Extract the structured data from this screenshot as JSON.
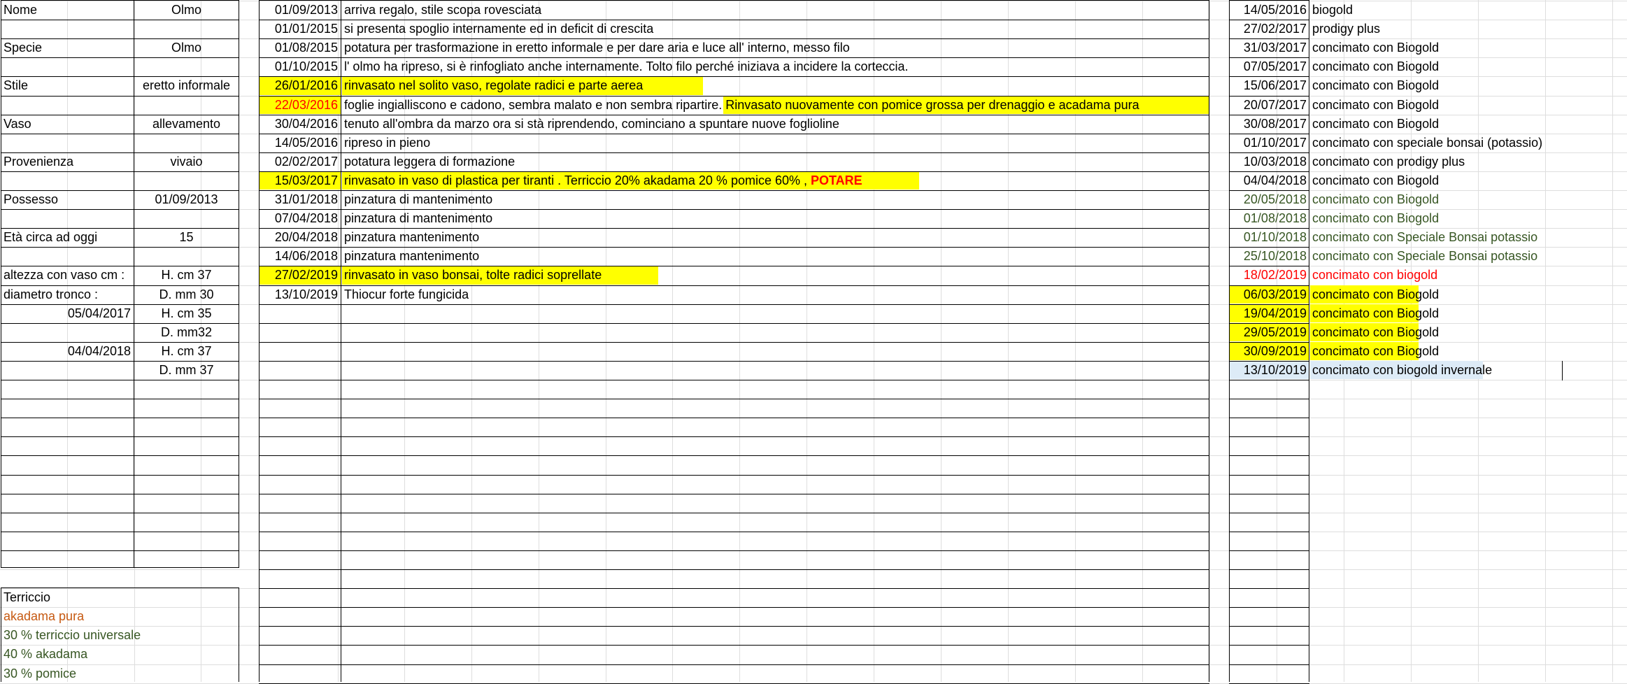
{
  "colors": {
    "highlight": "#ffff00",
    "light_blue": "#ddebf7",
    "red": "#ff0000",
    "green": "#375623",
    "orange": "#c65911"
  },
  "info": {
    "rows": [
      {
        "label": "Nome",
        "value": "Olmo"
      },
      {
        "label": "",
        "value": ""
      },
      {
        "label": "Specie",
        "value": "Olmo"
      },
      {
        "label": "",
        "value": ""
      },
      {
        "label": "Stile",
        "value": "eretto informale"
      },
      {
        "label": "",
        "value": ""
      },
      {
        "label": "Vaso",
        "value": "allevamento"
      },
      {
        "label": "",
        "value": ""
      },
      {
        "label": "Provenienza",
        "value": "vivaio"
      },
      {
        "label": "",
        "value": ""
      },
      {
        "label": "Possesso",
        "value": "01/09/2013"
      },
      {
        "label": "",
        "value": ""
      },
      {
        "label": "Età circa ad oggi",
        "value": "15"
      },
      {
        "label": "",
        "value": ""
      },
      {
        "label": "altezza con vaso cm :",
        "value": "H. cm 37"
      },
      {
        "label": "diametro tronco :",
        "value": "D. mm 30"
      },
      {
        "label": "05/04/2017",
        "value": "H. cm 35",
        "label_align": "right"
      },
      {
        "label": "",
        "value": "D. mm32"
      },
      {
        "label": "04/04/2018",
        "value": "H. cm 37",
        "label_align": "right"
      },
      {
        "label": "",
        "value": "D. mm 37"
      }
    ]
  },
  "soil": {
    "title": "Terriccio",
    "items": [
      {
        "text": "akadama pura",
        "color": "orange"
      },
      {
        "text": "30 % terriccio universale",
        "color": "green"
      },
      {
        "text": "40 % akadama",
        "color": "green"
      },
      {
        "text": "30 % pomice",
        "color": "green"
      }
    ]
  },
  "history": {
    "rows": [
      {
        "date": "01/09/2013",
        "text": "arriva regalo, stile scopa rovesciata"
      },
      {
        "date": "01/01/2015",
        "text": "si presenta spoglio internamente ed in deficit di crescita"
      },
      {
        "date": "01/08/2015",
        "text": "potatura per trasformazione in eretto informale e per dare aria e luce all' interno, messo filo"
      },
      {
        "date": "01/10/2015",
        "text": " l' olmo ha ripreso, si è rinfogliato anche internamente. Tolto filo perché iniziava a incidere la corteccia."
      },
      {
        "date": "26/01/2016",
        "text": "rinvasato nel solito vaso, regolate radici e parte aerea",
        "highlight": true
      },
      {
        "date": "22/03/2016",
        "text": "foglie ingialliscono e cadono, sembra malato e non sembra ripartire. Rinvasato nuovamente con pomice grossa per drenaggio e acadama pura",
        "highlight": true,
        "date_red": true
      },
      {
        "date": "30/04/2016",
        "text": "tenuto all'ombra da marzo ora si stà riprendendo, cominciano a spuntare nuove foglioline"
      },
      {
        "date": "14/05/2016",
        "text": "ripreso in pieno"
      },
      {
        "date": "02/02/2017",
        "text": "potatura leggera di formazione"
      },
      {
        "date": "15/03/2017",
        "text": "rinvasato in vaso di plastica per tiranti . Terriccio 20% akadama 20 % pomice 60% , ",
        "extra": "POTARE",
        "highlight": true
      },
      {
        "date": "31/01/2018",
        "text": "pinzatura di mantenimento"
      },
      {
        "date": "07/04/2018",
        "text": "pinzatura di mantenimento"
      },
      {
        "date": "20/04/2018",
        "text": "pinzatura mantenimento"
      },
      {
        "date": "14/06/2018",
        "text": "pinzatura mantenimento"
      },
      {
        "date": "27/02/2019",
        "text": "rinvasato in vaso bonsai, tolte radici soprellate",
        "highlight": true
      },
      {
        "date": "13/10/2019",
        "text": "Thiocur forte fungicida"
      }
    ]
  },
  "fertilizer": {
    "rows": [
      {
        "date": "14/05/2016",
        "text": "biogold"
      },
      {
        "date": "27/02/2017",
        "text": "prodigy plus"
      },
      {
        "date": "31/03/2017",
        "text": "concimato con Biogold"
      },
      {
        "date": "07/05/2017",
        "text": "concimato con Biogold"
      },
      {
        "date": "15/06/2017",
        "text": "concimato con Biogold"
      },
      {
        "date": "20/07/2017",
        "text": "concimato con Biogold"
      },
      {
        "date": "30/08/2017",
        "text": "concimato con Biogold"
      },
      {
        "date": "01/10/2017",
        "text": "concimato con speciale bonsai (potassio)"
      },
      {
        "date": "10/03/2018",
        "text": "concimato con prodigy plus"
      },
      {
        "date": "04/04/2018",
        "text": "concimato con Biogold"
      },
      {
        "date": "20/05/2018",
        "text": "concimato con Biogold",
        "color": "green"
      },
      {
        "date": "01/08/2018",
        "text": "concimato con Biogold",
        "color": "green"
      },
      {
        "date": "01/10/2018",
        "text": "concimato con Speciale Bonsai potassio",
        "color": "green"
      },
      {
        "date": "25/10/2018",
        "text": "concimato con Speciale Bonsai potassio",
        "color": "green"
      },
      {
        "date": "18/02/2019",
        "text": "concimato con biogold",
        "color": "red"
      },
      {
        "date": "06/03/2019",
        "text": "concimato con Biogold",
        "fill": "highlight"
      },
      {
        "date": "19/04/2019",
        "text": "concimato con Biogold",
        "fill": "highlight"
      },
      {
        "date": "29/05/2019",
        "text": "concimato con Biogold",
        "fill": "highlight"
      },
      {
        "date": "30/09/2019",
        "text": "concimato con Biogold",
        "fill": "highlight"
      },
      {
        "date": "13/10/2019",
        "text": "concimato con biogold invernale",
        "fill": "light_blue"
      }
    ]
  }
}
